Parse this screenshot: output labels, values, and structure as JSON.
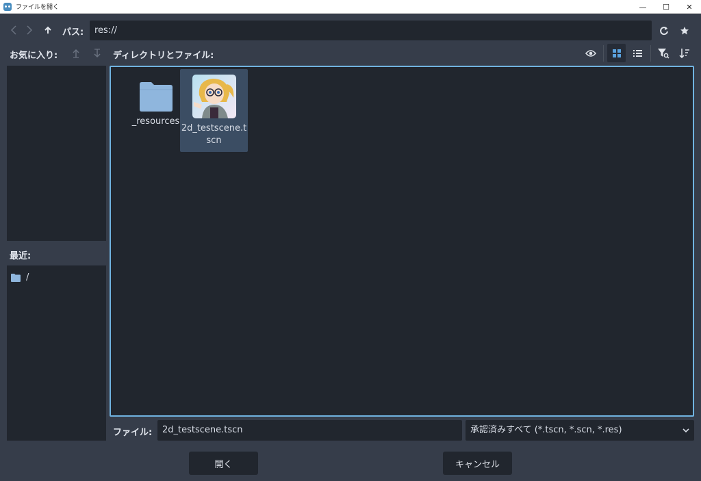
{
  "window": {
    "title": "ファイルを開く",
    "minimize": "—",
    "maximize": "☐",
    "close": "✕"
  },
  "toolbar": {
    "path_label": "パス:",
    "path_value": "res://"
  },
  "favorites": {
    "label": "お気に入り:"
  },
  "directory": {
    "label": "ディレクトリとファイル:"
  },
  "recent": {
    "label": "最近:",
    "items": [
      {
        "label": "/"
      }
    ]
  },
  "files": [
    {
      "name": "_resources",
      "type": "folder",
      "selected": false
    },
    {
      "name": "2d_testscene.tscn",
      "type": "scene",
      "selected": true
    }
  ],
  "bottom": {
    "file_label": "ファイル:",
    "file_value": "2d_testscene.tscn",
    "filter_value": "承認済みすべて (*.tscn, *.scn, *.res)"
  },
  "buttons": {
    "open": "開く",
    "cancel": "キャンセル"
  },
  "colors": {
    "accent": "#70b3e0",
    "folder": "#8fb6dd",
    "background": "#363d4a",
    "panel": "#21262e",
    "selection": "#3b4d63"
  }
}
